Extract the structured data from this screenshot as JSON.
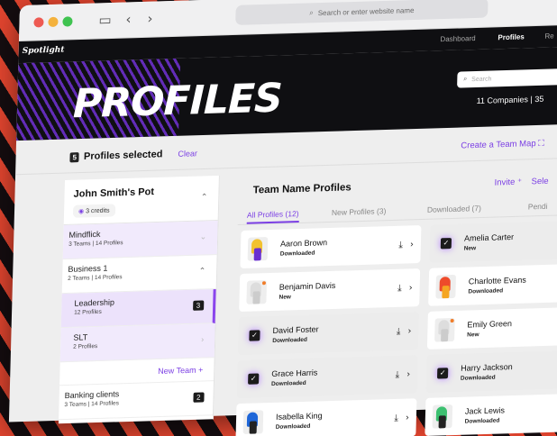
{
  "browser": {
    "url_placeholder": "Search or enter website name"
  },
  "app": {
    "logo": "Spotlight",
    "nav": [
      "Dashboard",
      "Profiles",
      "Re"
    ],
    "hero_title": "PROFILES",
    "search_placeholder": "Search",
    "companies": "11 Companies | 35"
  },
  "selection": {
    "count": "5",
    "label": "Profiles selected",
    "clear": "Clear",
    "create": "Create a Team Map"
  },
  "sidebar": {
    "pot_title": "John Smith's Pot",
    "credits": "3 credits",
    "teams": [
      {
        "name": "Mindflick",
        "meta": "3 Teams | 14 Profiles"
      },
      {
        "name": "Business 1",
        "meta": "2 Teams | 14 Profiles"
      },
      {
        "name": "Leadership",
        "meta": "12 Profiles",
        "badge": "3"
      },
      {
        "name": "SLT",
        "meta": "2 Profiles"
      }
    ],
    "new_team": "New Team",
    "banking": {
      "name": "Banking clients",
      "meta": "3 Teams | 14 Profiles",
      "badge": "2"
    }
  },
  "main": {
    "title": "Team Name Profiles",
    "invite": "Invite",
    "select": "Sele",
    "tabs": [
      "All Profiles (12)",
      "New Profiles (3)",
      "Downloaded (7)",
      "Pendi"
    ],
    "profiles_left": [
      {
        "name": "Aaron Brown",
        "status": "Downloaded"
      },
      {
        "name": "Benjamin Davis",
        "status": "New"
      },
      {
        "name": "David Foster",
        "status": "Downloaded"
      },
      {
        "name": "Grace Harris",
        "status": "Downloaded"
      },
      {
        "name": "Isabella King",
        "status": "Downloaded"
      }
    ],
    "profiles_right": [
      {
        "name": "Amelia Carter",
        "status": "New"
      },
      {
        "name": "Charlotte Evans",
        "status": "Downloaded"
      },
      {
        "name": "Emily Green",
        "status": "New"
      },
      {
        "name": "Harry Jackson",
        "status": "Downloaded"
      },
      {
        "name": "Jack Lewis",
        "status": "Downloaded"
      }
    ]
  },
  "colors": {
    "accent": "#7b3fe4",
    "stripe_red": "#e2452f",
    "dark": "#0f0f12"
  }
}
